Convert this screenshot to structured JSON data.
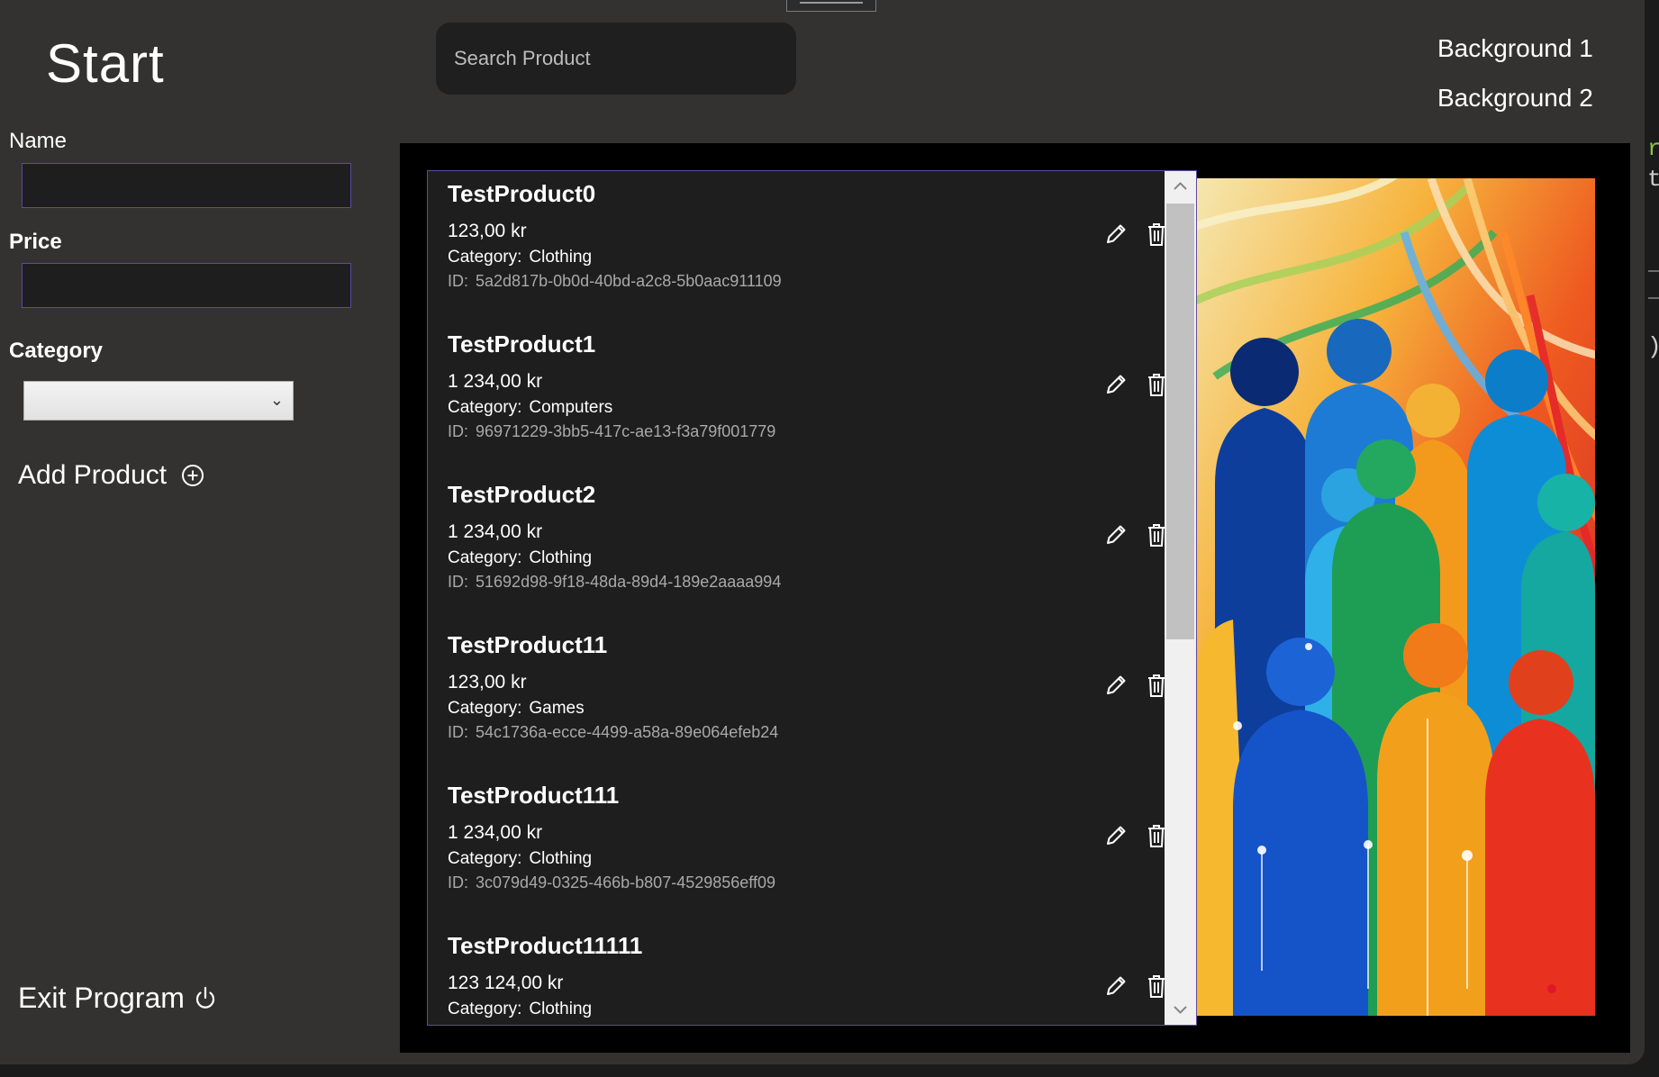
{
  "window": {
    "title": "Start"
  },
  "form": {
    "name_label": "Name",
    "name_value": "",
    "price_label": "Price",
    "price_value": "",
    "category_label": "Category",
    "category_selected": "",
    "add_product_label": "Add Product"
  },
  "exit_label": "Exit Program",
  "search": {
    "placeholder": "Search Product",
    "value": ""
  },
  "backgrounds": [
    "Background 1",
    "Background 2"
  ],
  "product_fields": {
    "category_label": "Category:",
    "id_label": "ID:"
  },
  "products": [
    {
      "name": "TestProduct0",
      "price": "123,00 kr",
      "category": "Clothing",
      "id": "5a2d817b-0b0d-40bd-a2c8-5b0aac911109"
    },
    {
      "name": "TestProduct1",
      "price": "1 234,00 kr",
      "category": "Computers",
      "id": "96971229-3bb5-417c-ae13-f3a79f001779"
    },
    {
      "name": "TestProduct2",
      "price": "1 234,00 kr",
      "category": "Clothing",
      "id": "51692d98-9f18-48da-89d4-189e2aaaa994"
    },
    {
      "name": "TestProduct11",
      "price": "123,00 kr",
      "category": "Games",
      "id": "54c1736a-ecce-4499-a58a-89e064efeb24"
    },
    {
      "name": "TestProduct111",
      "price": "1 234,00 kr",
      "category": "Clothing",
      "id": "3c079d49-0325-466b-b807-4529856eff09"
    },
    {
      "name": "TestProduct11111",
      "price": "123 124,00 kr",
      "category": "Clothing",
      "id": ""
    }
  ],
  "icons": {
    "add": "plus-circle-icon",
    "exit": "power-icon",
    "edit": "pencil-icon",
    "delete": "trash-icon",
    "select": "chevron-down-icon"
  },
  "colors": {
    "window_bg": "#333231",
    "panel_bg": "#000000",
    "list_bg": "#1e1e1e",
    "input_bg": "#1e1e1e",
    "accent_border": "#5e4a9e",
    "secondary_text": "#a9a9a9"
  }
}
